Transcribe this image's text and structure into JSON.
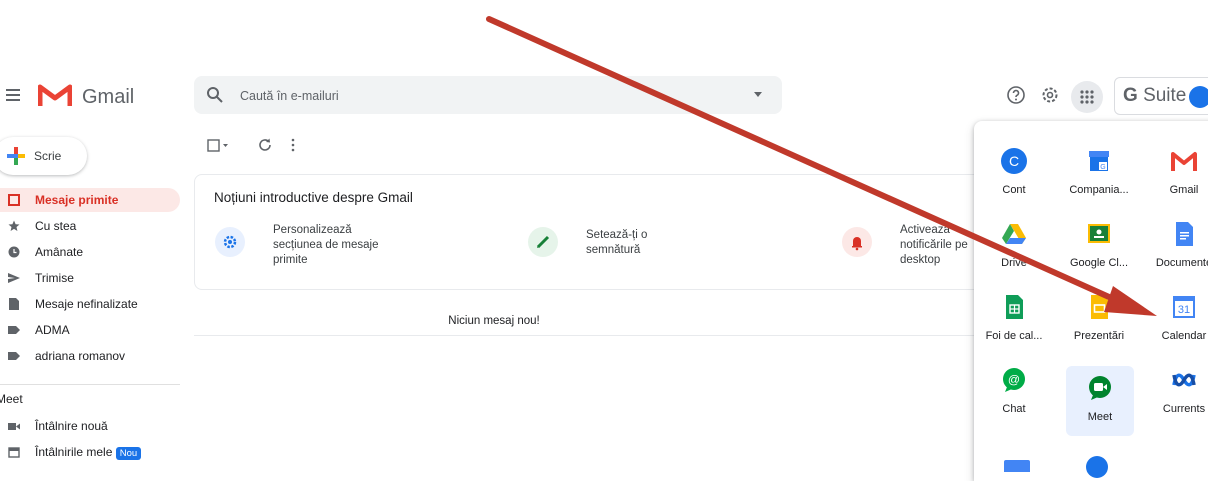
{
  "header": {
    "product_name": "Gmail",
    "search_placeholder": "Caută în e-mailuri",
    "brand": "Suite",
    "brand_g": "G"
  },
  "compose": {
    "label": "Scrie"
  },
  "sidebar": {
    "items": [
      {
        "label": "Mesaje primite",
        "icon": "inbox-icon"
      },
      {
        "label": "Cu stea",
        "icon": "star-icon"
      },
      {
        "label": "Amânate",
        "icon": "clock-icon"
      },
      {
        "label": "Trimise",
        "icon": "send-icon"
      },
      {
        "label": "Mesaje nefinalizate",
        "icon": "draft-icon"
      },
      {
        "label": "ADMA",
        "icon": "label-icon"
      },
      {
        "label": "adriana romanov",
        "icon": "label-icon"
      }
    ],
    "meet": {
      "heading": "Meet",
      "items": [
        {
          "label": "Întâlnire nouă",
          "icon": "video-icon"
        },
        {
          "label": "Întâlnirile mele",
          "icon": "calendar-small-icon",
          "badge": "Nou"
        }
      ]
    }
  },
  "intro": {
    "title": "Noțiuni introductive despre Gmail",
    "tips": [
      {
        "text": "Personalizează secțiunea de mesaje primite",
        "icon": "settings-icon",
        "color": "#1a73e8"
      },
      {
        "text": "Setează-ți o semnătură",
        "icon": "pen-icon",
        "color": "#188038"
      },
      {
        "text": "Activează notificările pe desktop",
        "icon": "bell-icon",
        "color": "#d93025"
      }
    ]
  },
  "empty_message": "Niciun mesaj nou!",
  "apps_panel": {
    "apps": [
      {
        "label": "Cont",
        "icon": "account-icon"
      },
      {
        "label": "Compania...",
        "icon": "business-icon"
      },
      {
        "label": "Gmail",
        "icon": "gmail-icon"
      },
      {
        "label": "Drive",
        "icon": "drive-icon"
      },
      {
        "label": "Google Cl...",
        "icon": "classroom-icon"
      },
      {
        "label": "Documente",
        "icon": "docs-icon"
      },
      {
        "label": "Foi de cal...",
        "icon": "sheets-icon"
      },
      {
        "label": "Prezentări",
        "icon": "slides-icon"
      },
      {
        "label": "Calendar",
        "icon": "calendar-icon",
        "day": "31"
      },
      {
        "label": "Chat",
        "icon": "chat-icon"
      },
      {
        "label": "Meet",
        "icon": "meet-icon"
      },
      {
        "label": "Currents",
        "icon": "currents-icon"
      }
    ]
  },
  "colors": {
    "accent_red": "#d93025",
    "blue": "#1a73e8",
    "annotation_arrow": "#c0392b"
  }
}
